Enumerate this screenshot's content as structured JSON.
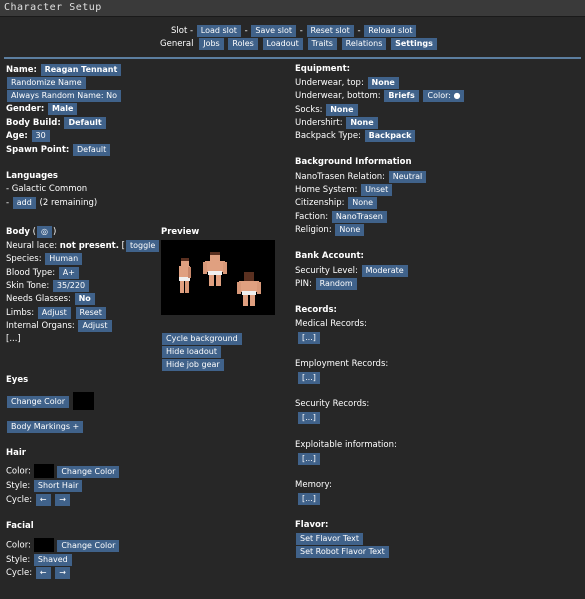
{
  "window": {
    "title": "Character Setup"
  },
  "topbar": {
    "slot_label": "Slot -",
    "load_slot": "Load slot",
    "save_slot": "Save slot",
    "reset_slot": "Reset slot",
    "reload_slot": "Reload slot",
    "sep": "-",
    "tabs": [
      "General",
      "Jobs",
      "Roles",
      "Loadout",
      "Traits",
      "Relations",
      "Settings"
    ]
  },
  "general": {
    "name_label": "Name:",
    "name_value": "Reagan Tennant",
    "randomize_name": "Randomize Name",
    "always_random": "Always Random Name: No",
    "gender_label": "Gender:",
    "gender_value": "Male",
    "body_build_label": "Body Build:",
    "body_build_value": "Default",
    "age_label": "Age:",
    "age_value": "30",
    "spawn_label": "Spawn Point:",
    "spawn_value": "Default"
  },
  "languages": {
    "header": "Languages",
    "item": "- Galactic Common",
    "add_prefix": "-",
    "add_btn": "add",
    "remaining": "(2 remaining)"
  },
  "body": {
    "header": "Body",
    "toggle_icon_btn": "◎",
    "paren_open": "(",
    "paren_close": ")",
    "neural_lace_label": "Neural lace:",
    "neural_lace_value": "not present.",
    "toggle_btn": "toggle",
    "bracket_open": "[",
    "bracket_close": "]",
    "species_label": "Species:",
    "species_value": "Human",
    "blood_label": "Blood Type:",
    "blood_value": "A+",
    "skin_label": "Skin Tone:",
    "skin_value": "35/220",
    "glasses_label": "Needs Glasses:",
    "glasses_value": "No",
    "limbs_label": "Limbs:",
    "limbs_adjust": "Adjust",
    "limbs_reset": "Reset",
    "organs_label": "Internal Organs:",
    "organs_adjust": "Adjust",
    "ellipsis": "[...]"
  },
  "preview": {
    "header": "Preview",
    "cycle_bg": "Cycle background",
    "hide_loadout": "Hide loadout",
    "hide_job_gear": "Hide job gear"
  },
  "eyes": {
    "header": "Eyes",
    "change_color": "Change Color",
    "color": "#000000"
  },
  "markings": {
    "btn": "Body Markings +"
  },
  "hair": {
    "header": "Hair",
    "color_label": "Color:",
    "change_color": "Change Color",
    "style_label": "Style:",
    "style_value": "Short Hair",
    "cycle_label": "Cycle:",
    "prev": "←",
    "next": "→"
  },
  "facial": {
    "header": "Facial",
    "color_label": "Color:",
    "change_color": "Change Color",
    "style_label": "Style:",
    "style_value": "Shaved",
    "cycle_label": "Cycle:",
    "prev": "←",
    "next": "→"
  },
  "equipment": {
    "header": "Equipment:",
    "underwear_top_label": "Underwear, top:",
    "underwear_top_value": "None",
    "underwear_bottom_label": "Underwear, bottom:",
    "underwear_bottom_value": "Briefs",
    "underwear_color_btn": "Color: ●",
    "socks_label": "Socks:",
    "socks_value": "None",
    "undershirt_label": "Undershirt:",
    "undershirt_value": "None",
    "backpack_label": "Backpack Type:",
    "backpack_value": "Backpack"
  },
  "background": {
    "header": "Background Information",
    "nt_label": "NanoTrasen Relation:",
    "nt_value": "Neutral",
    "home_label": "Home System:",
    "home_value": "Unset",
    "citizenship_label": "Citizenship:",
    "citizenship_value": "None",
    "faction_label": "Faction:",
    "faction_value": "NanoTrasen",
    "religion_label": "Religion:",
    "religion_value": "None"
  },
  "bank": {
    "header": "Bank Account:",
    "security_label": "Security Level:",
    "security_value": "Moderate",
    "pin_label": "PIN:",
    "pin_value": "Random"
  },
  "records": {
    "header": "Records:",
    "medical_label": "Medical Records:",
    "employment_label": "Employment Records:",
    "security_label": "Security Records:",
    "exploitable_label": "Exploitable information:",
    "memory_label": "Memory:",
    "edit_btn": "[...]"
  },
  "flavor": {
    "header": "Flavor:",
    "set_flavor": "Set Flavor Text",
    "set_robot_flavor": "Set Robot Flavor Text"
  },
  "colors": {
    "background": "#272727",
    "button": "#40628a",
    "selected_tab": "#2f943c",
    "divider": "#5c7ea0"
  }
}
